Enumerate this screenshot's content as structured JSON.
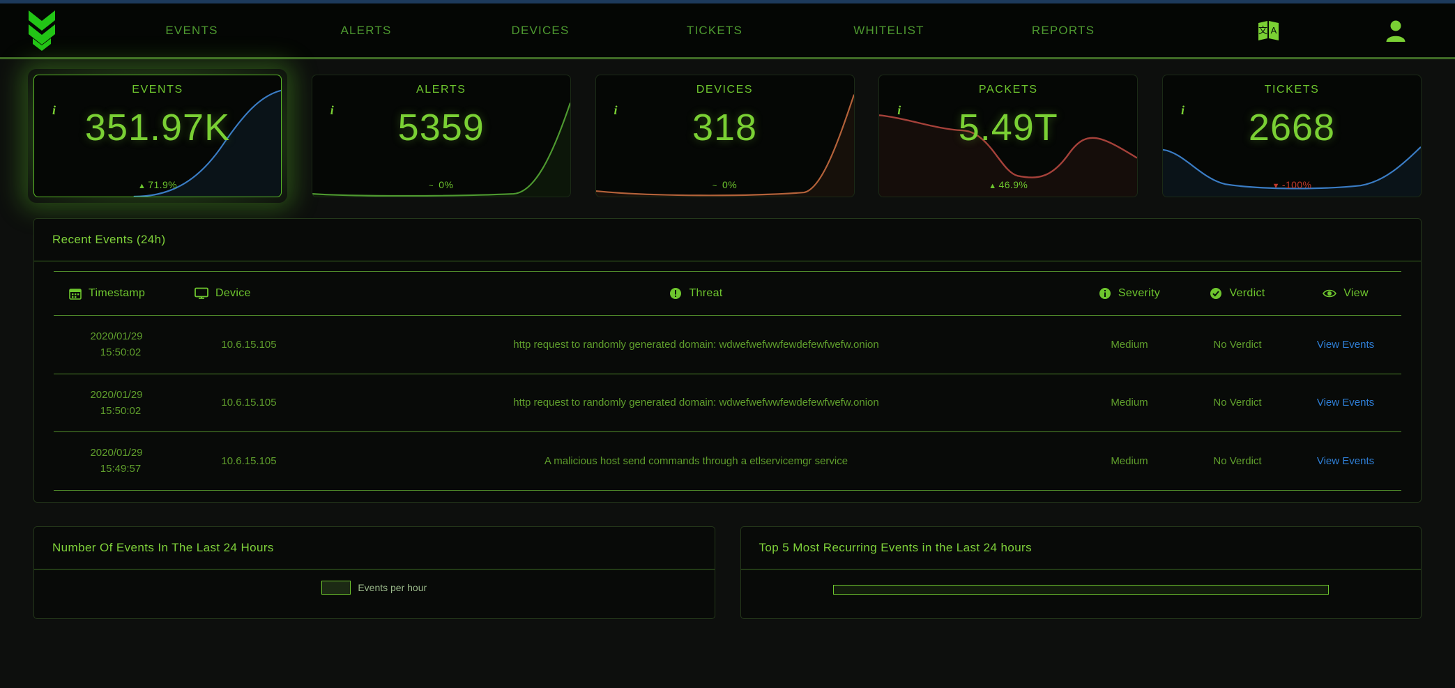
{
  "nav": {
    "logo_icon": "chevron-double-down-logo",
    "items": [
      {
        "label": "EVENTS"
      },
      {
        "label": "ALERTS"
      },
      {
        "label": "DEVICES"
      },
      {
        "label": "TICKETS"
      },
      {
        "label": "WHITELIST"
      },
      {
        "label": "REPORTS"
      }
    ],
    "language_icon": "language-translate-icon",
    "user_icon": "user-account-icon"
  },
  "kpis": [
    {
      "title": "EVENTS",
      "value": "351.97K",
      "delta": "71.9%",
      "delta_dir": "up",
      "delta_symbol": "▲",
      "spark_color": "#3a7cc4",
      "selected": true,
      "info_icon": "info-icon"
    },
    {
      "title": "ALERTS",
      "value": "5359",
      "delta": "0%",
      "delta_dir": "flat",
      "delta_symbol": "~",
      "spark_color": "#4e9a30",
      "selected": false,
      "info_icon": "info-icon"
    },
    {
      "title": "DEVICES",
      "value": "318",
      "delta": "0%",
      "delta_dir": "flat",
      "delta_symbol": "~",
      "spark_color": "#b4623a",
      "selected": false,
      "info_icon": "info-icon"
    },
    {
      "title": "PACKETS",
      "value": "5.49T",
      "delta": "46.9%",
      "delta_dir": "up",
      "delta_symbol": "▲",
      "spark_color": "#a5413a",
      "selected": false,
      "info_icon": "info-icon"
    },
    {
      "title": "TICKETS",
      "value": "2668",
      "delta": "-100%",
      "delta_dir": "down",
      "delta_symbol": "▼",
      "spark_color": "#3a7cc4",
      "selected": false,
      "info_icon": "info-icon"
    }
  ],
  "recent_events": {
    "title": "Recent Events (24h)",
    "columns": [
      {
        "label": "Timestamp",
        "icon": "calendar-icon"
      },
      {
        "label": "Device",
        "icon": "monitor-icon"
      },
      {
        "label": "Threat",
        "icon": "exclamation-circle-icon"
      },
      {
        "label": "Severity",
        "icon": "info-circle-icon"
      },
      {
        "label": "Verdict",
        "icon": "check-circle-icon"
      },
      {
        "label": "View",
        "icon": "eye-icon"
      }
    ],
    "rows": [
      {
        "date": "2020/01/29",
        "time": "15:50:02",
        "device": "10.6.15.105",
        "threat": "http request to randomly generated domain: wdwefwefwwfewdefewfwefw.onion",
        "severity": "Medium",
        "verdict": "No Verdict",
        "view": "View Events"
      },
      {
        "date": "2020/01/29",
        "time": "15:50:02",
        "device": "10.6.15.105",
        "threat": "http request to randomly generated domain: wdwefwefwwfewdefewfwefw.onion",
        "severity": "Medium",
        "verdict": "No Verdict",
        "view": "View Events"
      },
      {
        "date": "2020/01/29",
        "time": "15:49:57",
        "device": "10.6.15.105",
        "threat": "A malicious host send commands through a etlservicemgr service",
        "severity": "Medium",
        "verdict": "No Verdict",
        "view": "View Events"
      }
    ]
  },
  "bottom_panels": {
    "events_chart": {
      "title": "Number Of Events In The Last 24 Hours",
      "legend_label": "Events per hour"
    },
    "top_recurring": {
      "title": "Top 5 Most Recurring Events in the Last 24 hours"
    }
  },
  "colors": {
    "accent_green": "#6ec62e",
    "link_blue": "#2f7fd6",
    "danger_red": "#c0392b",
    "background": "#0d0f0d"
  },
  "chart_data": [
    {
      "type": "line",
      "title": "Number Of Events In The Last 24 Hours",
      "xlabel": "",
      "ylabel": "",
      "legend": [
        "Events per hour"
      ],
      "legend_position": "top-center",
      "categories": [],
      "values": []
    },
    {
      "type": "bar",
      "title": "Top 5 Most Recurring Events in the Last 24 hours",
      "xlabel": "",
      "ylabel": "",
      "categories": [],
      "values": []
    }
  ]
}
